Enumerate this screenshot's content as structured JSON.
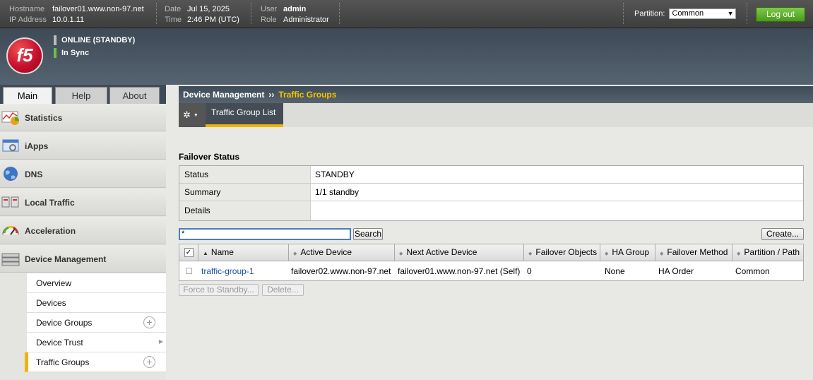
{
  "topbar": {
    "hostname_label": "Hostname",
    "hostname": "failover01.www.non-97.net",
    "ip_label": "IP Address",
    "ip": "10.0.1.11",
    "date_label": "Date",
    "date": "Jul 15, 2025",
    "time_label": "Time",
    "time": "2:46 PM (UTC)",
    "user_label": "User",
    "user": "admin",
    "role_label": "Role",
    "role": "Administrator",
    "partition_label": "Partition:",
    "partition_value": "Common",
    "logout": "Log out"
  },
  "header": {
    "logo_text": "f5",
    "status_online": "ONLINE (STANDBY)",
    "status_sync": "In Sync"
  },
  "tabs": [
    "Main",
    "Help",
    "About"
  ],
  "sidebar": {
    "items": [
      {
        "label": "Statistics",
        "icon": "statistics-icon"
      },
      {
        "label": "iApps",
        "icon": "iapps-icon"
      },
      {
        "label": "DNS",
        "icon": "dns-globe-icon"
      },
      {
        "label": "Local Traffic",
        "icon": "local-traffic-icon"
      },
      {
        "label": "Acceleration",
        "icon": "acceleration-gauge-icon"
      },
      {
        "label": "Device Management",
        "icon": "device-management-icon"
      }
    ],
    "subitems": [
      {
        "label": "Overview"
      },
      {
        "label": "Devices"
      },
      {
        "label": "Device Groups"
      },
      {
        "label": "Device Trust"
      },
      {
        "label": "Traffic Groups"
      }
    ]
  },
  "breadcrumb": {
    "parent": "Device Management",
    "separator": "››",
    "current": "Traffic Groups"
  },
  "subbar": {
    "tab": "Traffic Group List"
  },
  "failover": {
    "title": "Failover Status",
    "rows": [
      {
        "key": "Status",
        "value": "STANDBY"
      },
      {
        "key": "Summary",
        "value": "1/1 standby"
      },
      {
        "key": "Details",
        "value": ""
      }
    ]
  },
  "search": {
    "value": "*",
    "button": "Search",
    "create": "Create..."
  },
  "table": {
    "columns": [
      "Name",
      "Active Device",
      "Next Active Device",
      "Failover Objects",
      "HA Group",
      "Failover Method",
      "Partition / Path"
    ],
    "rows": [
      {
        "name": "traffic-group-1",
        "active_device": "failover02.www.non-97.net",
        "next_active_device": "failover01.www.non-97.net (Self)",
        "failover_objects": "0",
        "ha_group": "None",
        "failover_method": "HA Order",
        "partition": "Common"
      }
    ]
  },
  "actions": {
    "force_standby": "Force to Standby...",
    "delete": "Delete..."
  },
  "colors": {
    "accent_yellow": "#f0b400",
    "logout_green": "#5aaa28",
    "link_blue": "#1a4ea8",
    "logo_red": "#c8102e"
  }
}
